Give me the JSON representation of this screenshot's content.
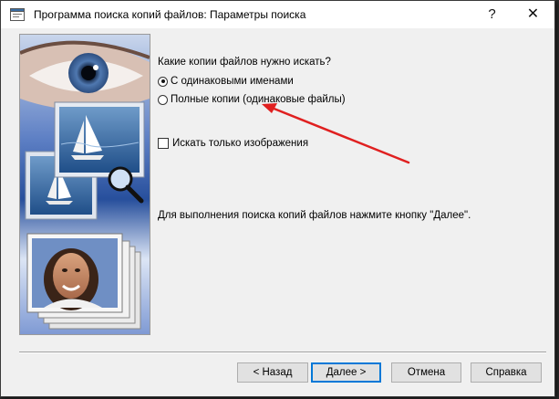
{
  "window": {
    "title": "Программа поиска копий файлов: Параметры поиска",
    "help_button": "?",
    "close_button": "✕"
  },
  "search_options": {
    "question": "Какие копии файлов нужно искать?",
    "options": [
      {
        "label": "С одинаковыми именами",
        "selected": true
      },
      {
        "label": "Полные копии (одинаковые файлы)",
        "selected": false
      }
    ],
    "images_only": {
      "label": "Искать только изображения",
      "checked": false
    }
  },
  "hint": "Для выполнения поиска копий файлов нажмите кнопку \"Далее\".",
  "buttons": {
    "back": "< Назад",
    "next": "Далее >",
    "cancel": "Отмена",
    "help": "Справка"
  },
  "annotation": {
    "arrow_color": "#e02020",
    "icon": "red-arrow-annotation"
  }
}
